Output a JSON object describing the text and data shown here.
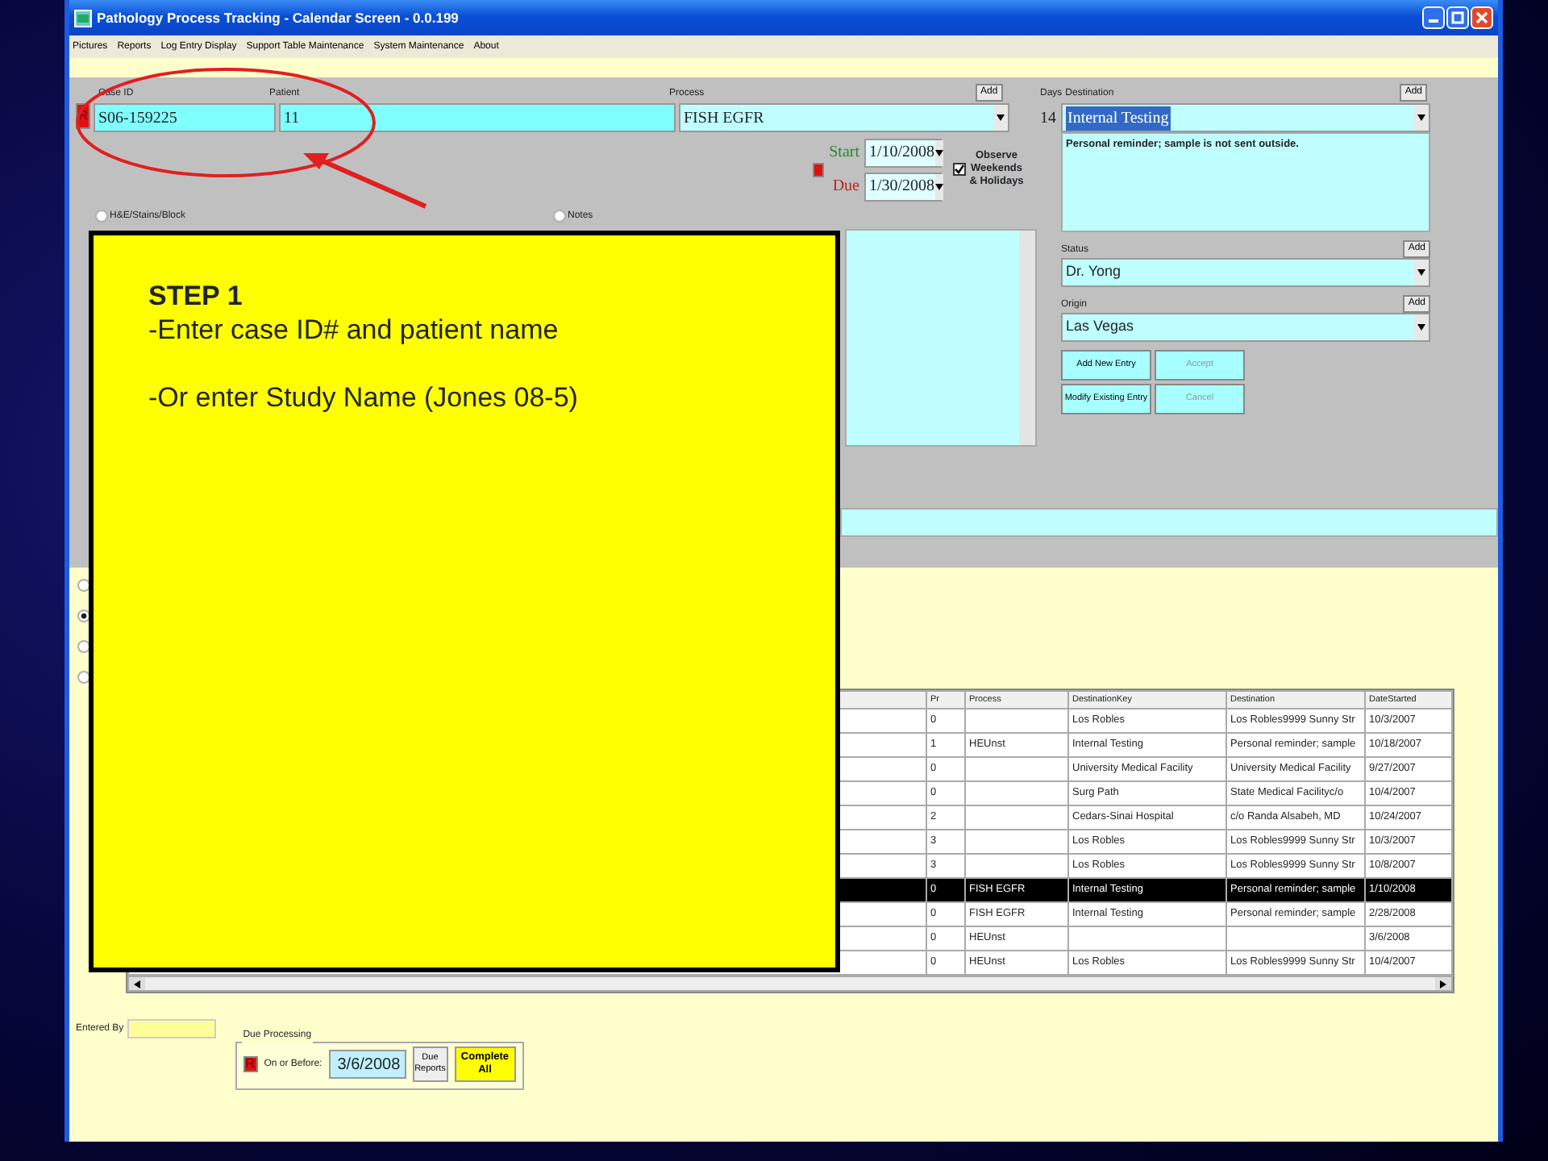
{
  "window": {
    "title": "Pathology Process Tracking - Calendar Screen - 0.0.199"
  },
  "menu": [
    "Pictures",
    "Reports",
    "Log Entry Display",
    "Support Table Maintenance",
    "System Maintenance",
    "About"
  ],
  "case_id": {
    "label": "Case ID",
    "flag": "R",
    "value": "S06-159225"
  },
  "patient": {
    "label": "Patient",
    "value": "11"
  },
  "process": {
    "label": "Process",
    "value": "FISH EGFR",
    "add": "Add"
  },
  "days": {
    "label": "Days",
    "value": "14"
  },
  "destination": {
    "label": "Destination",
    "value": "Internal Testing",
    "add": "Add",
    "note": "Personal reminder; sample is not sent outside."
  },
  "dates": {
    "start_label": "Start",
    "start": "1/10/2008",
    "due_label": "Due",
    "due": "1/30/2008"
  },
  "observe": {
    "label": "Observe Weekends & Holidays",
    "checked": true
  },
  "sections": [
    {
      "label": "H&E/Stains/Block",
      "selected": false
    },
    {
      "label": "Notes",
      "selected": false
    }
  ],
  "status": {
    "label": "Status",
    "value": "Dr. Yong",
    "add": "Add"
  },
  "origin": {
    "label": "Origin",
    "value": "Las Vegas",
    "add": "Add"
  },
  "buttons": [
    {
      "label": "Add New Entry",
      "disabled": false
    },
    {
      "label": "Accept",
      "disabled": true
    },
    {
      "label": "Modify Existing Entry",
      "disabled": false
    },
    {
      "label": "Cancel",
      "disabled": true
    }
  ],
  "view_options": [
    {
      "selected": false
    },
    {
      "selected": true
    },
    {
      "selected": false
    },
    {
      "selected": false
    }
  ],
  "table": {
    "columns": [
      "Pr",
      "Process",
      "DestinationKey",
      "Destination",
      "DateStarted"
    ],
    "rows": [
      {
        "pr": "0",
        "destination_key": "Los Robles",
        "destination": "Los Robles9999 Sunny Str",
        "date_started": "10/3/2007",
        "selected": false
      },
      {
        "pr": "1",
        "process": "HEUnst",
        "destination_key": "Internal Testing",
        "destination": "Personal reminder; sample",
        "date_started": "10/18/2007",
        "selected": false
      },
      {
        "pr": "0",
        "destination_key": "University Medical Facility",
        "destination": "University Medical Facility",
        "date_started": "9/27/2007",
        "selected": false
      },
      {
        "pr": "0",
        "destination_key": "Surg Path",
        "destination": "State Medical Facilityc/o",
        "date_started": "10/4/2007",
        "selected": false
      },
      {
        "pr": "2",
        "destination_key": "Cedars-Sinai Hospital",
        "destination": "c/o  Randa Alsabeh, MD",
        "date_started": "10/24/2007",
        "selected": false
      },
      {
        "pr": "3",
        "destination_key": "Los Robles",
        "destination": "Los Robles9999 Sunny Str",
        "date_started": "10/3/2007",
        "selected": false
      },
      {
        "pr": "3",
        "destination_key": "Los Robles",
        "destination": "Los Robles9999 Sunny Str",
        "date_started": "10/8/2007",
        "selected": false
      },
      {
        "pr": "0",
        "process": "FISH EGFR",
        "destination_key": "Internal Testing",
        "destination": "Personal reminder; sample",
        "date_started": "1/10/2008",
        "selected": true
      },
      {
        "pr": "0",
        "process": "FISH EGFR",
        "destination_key": "Internal Testing",
        "destination": "Personal reminder; sample",
        "date_started": "2/28/2008",
        "selected": false
      },
      {
        "pr": "0",
        "process": "HEUnst",
        "date_started": "3/6/2008",
        "selected": false
      },
      {
        "pr": "0",
        "process": "HEUnst",
        "destination_key": "Los Robles",
        "destination": "Los Robles9999 Sunny Str",
        "date_started": "10/4/2007",
        "selected": false
      }
    ]
  },
  "entered_by": {
    "label": "Entered By"
  },
  "due_processing": {
    "title": "Due Processing",
    "flag": "R",
    "label": "On or Before:",
    "date": "3/6/2008",
    "reports_button": "Due Reports",
    "complete_button": "Complete All"
  },
  "callout": {
    "title": "STEP 1",
    "lines": [
      "-Enter case ID# and patient name",
      "-Or enter Study Name (Jones 08-5)"
    ]
  }
}
